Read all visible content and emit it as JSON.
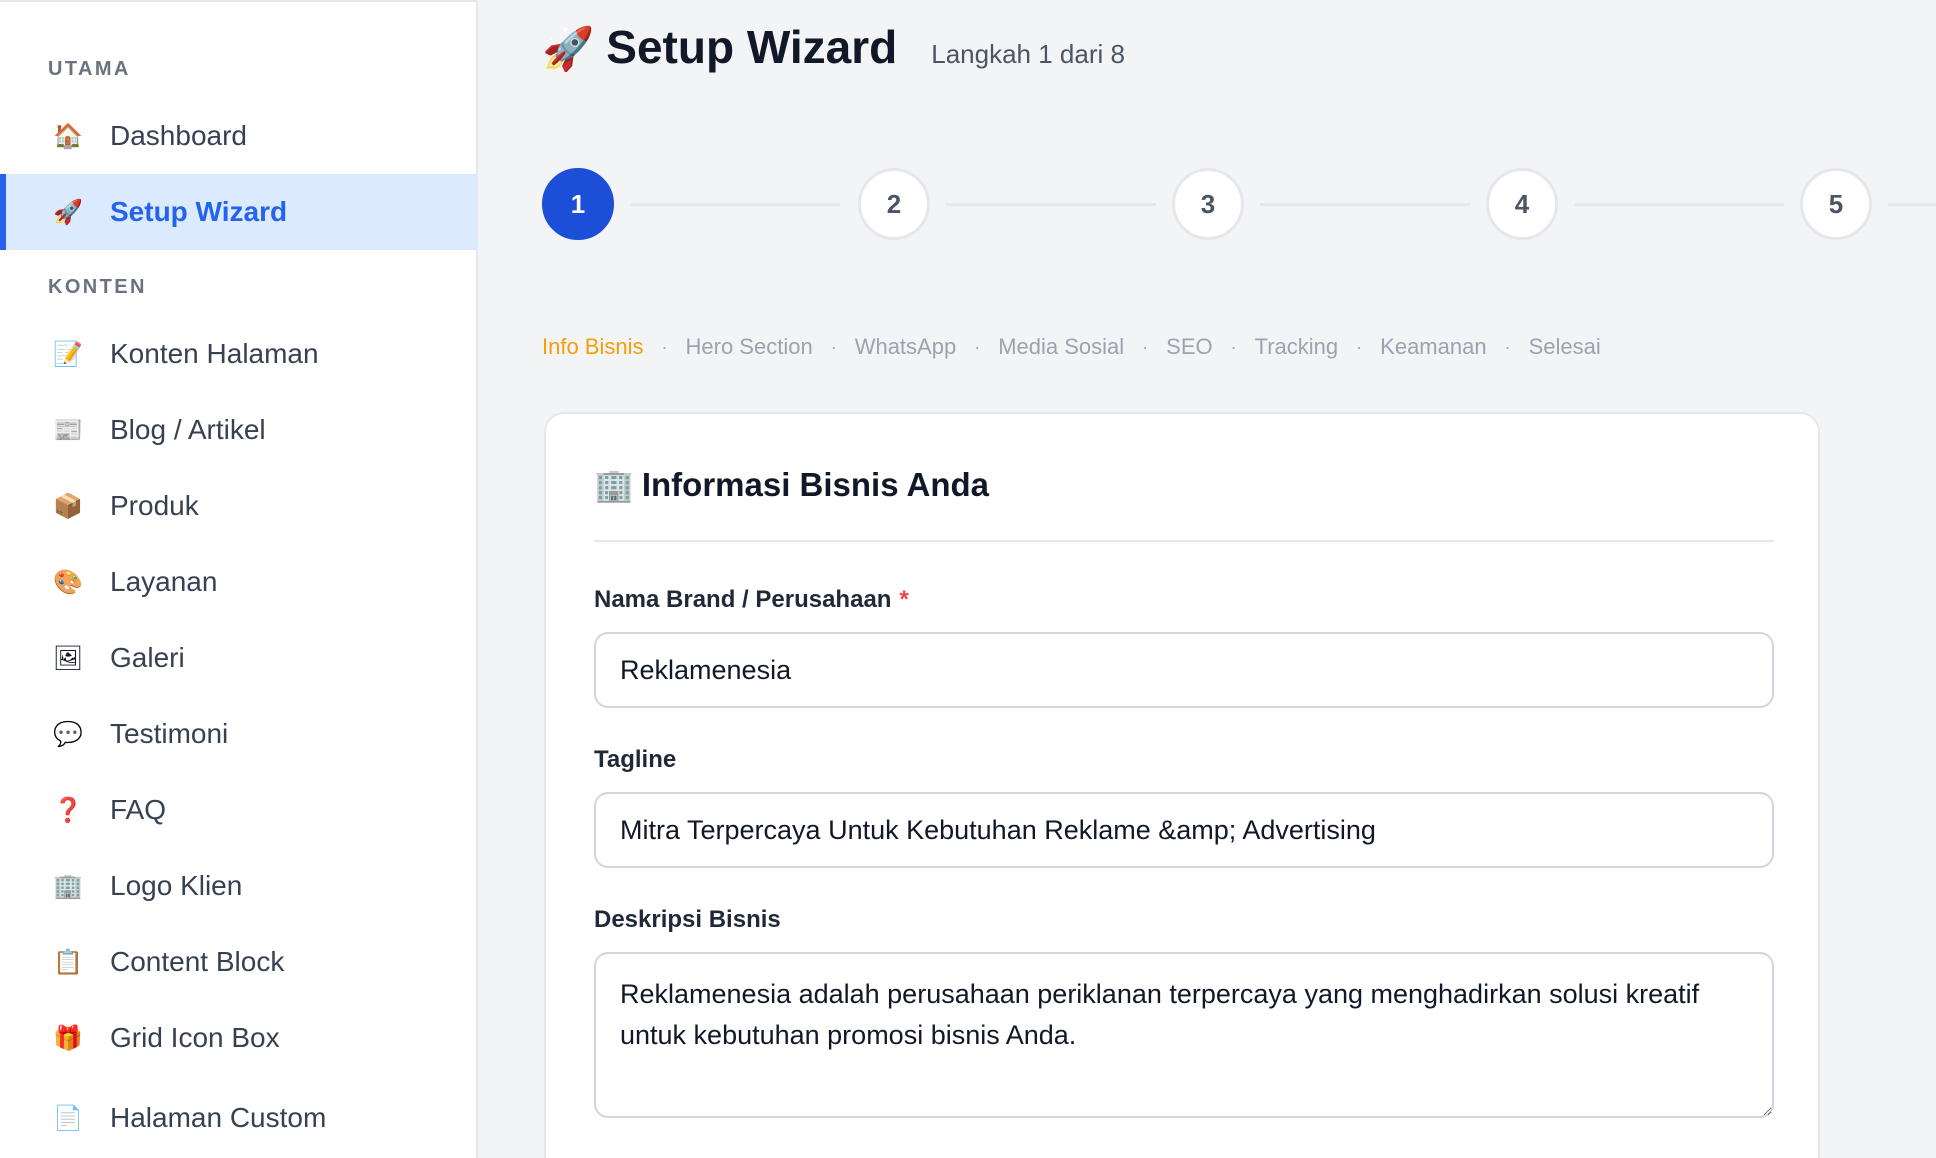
{
  "sidebar": {
    "sections": [
      {
        "label": "UTAMA"
      },
      {
        "label": "KONTEN"
      }
    ],
    "items": [
      {
        "icon": "🏠",
        "label": "Dashboard"
      },
      {
        "icon": "🚀",
        "label": "Setup Wizard"
      },
      {
        "icon": "📝",
        "label": "Konten Halaman"
      },
      {
        "icon": "📰",
        "label": "Blog / Artikel"
      },
      {
        "icon": "📦",
        "label": "Produk"
      },
      {
        "icon": "🎨",
        "label": "Layanan"
      },
      {
        "icon": "🖼",
        "label": "Galeri"
      },
      {
        "icon": "💬",
        "label": "Testimoni"
      },
      {
        "icon": "❓",
        "label": "FAQ"
      },
      {
        "icon": "🏢",
        "label": "Logo Klien"
      },
      {
        "icon": "📋",
        "label": "Content Block"
      },
      {
        "icon": "🎁",
        "label": "Grid Icon Box"
      },
      {
        "icon": "📄",
        "label": "Halaman Custom"
      }
    ],
    "active_item": "Setup Wizard"
  },
  "header": {
    "icon": "🚀",
    "title": "Setup Wizard",
    "step_count": "Langkah 1 dari 8"
  },
  "stepper": {
    "steps": [
      "1",
      "2",
      "3",
      "4",
      "5"
    ],
    "active": "1"
  },
  "substeps": {
    "items": [
      "Info Bisnis",
      "Hero Section",
      "WhatsApp",
      "Media Sosial",
      "SEO",
      "Tracking",
      "Keamanan",
      "Selesai"
    ],
    "separator": "·",
    "active": "Info Bisnis"
  },
  "form": {
    "icon": "🏢",
    "title": "Informasi Bisnis Anda",
    "brand": {
      "label": "Nama Brand / Perusahaan",
      "required_mark": "*",
      "value": "Reklamenesia"
    },
    "tagline": {
      "label": "Tagline",
      "value": "Mitra Terpercaya Untuk Kebutuhan Reklame &amp; Advertising"
    },
    "description": {
      "label": "Deskripsi Bisnis",
      "value": "Reklamenesia adalah perusahaan periklanan terpercaya yang menghadirkan solusi kreatif untuk kebutuhan promosi bisnis Anda."
    }
  },
  "colors": {
    "accent": "#2563eb",
    "active_substep": "#f59e0b",
    "required": "#ef4444"
  }
}
